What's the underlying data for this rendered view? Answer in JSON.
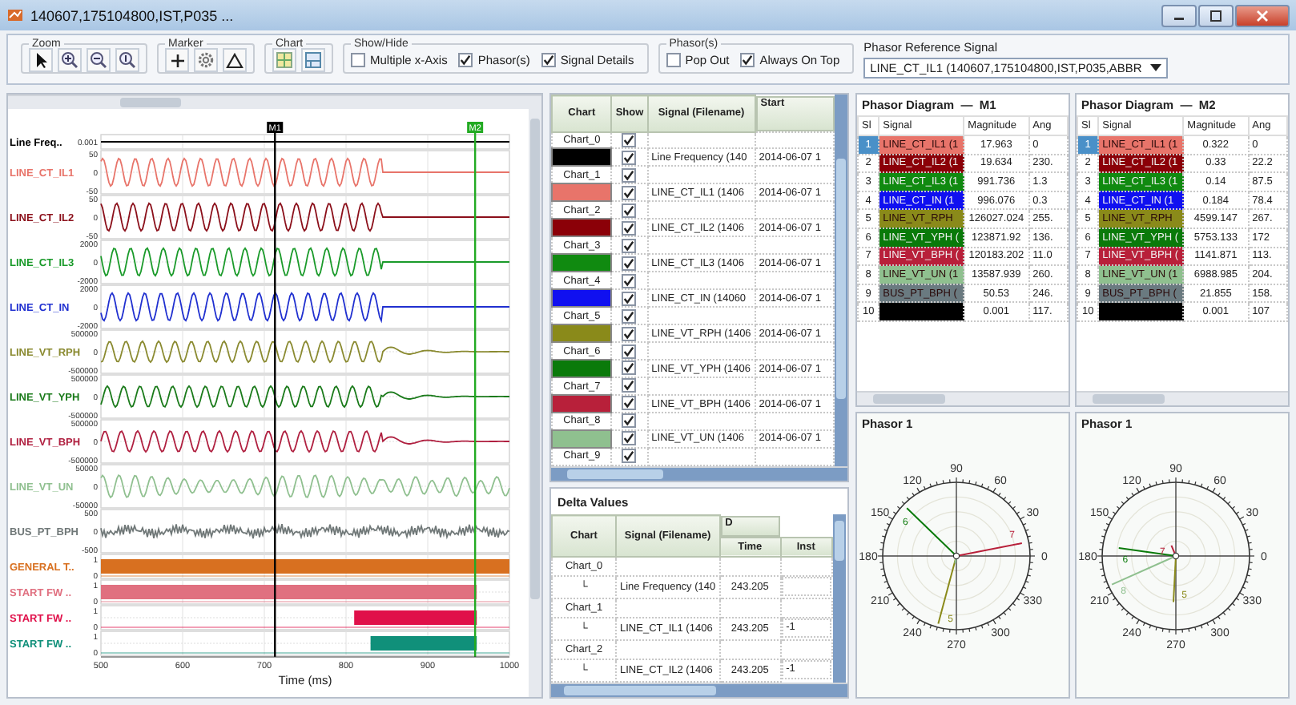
{
  "window": {
    "title": "140607,175104800,IST,P035 ..."
  },
  "toolbar": {
    "zoom": {
      "label": "Zoom"
    },
    "marker": {
      "label": "Marker"
    },
    "chart": {
      "label": "Chart"
    },
    "show_hide": {
      "label": "Show/Hide",
      "options": [
        {
          "label": "Multiple x-Axis",
          "checked": false
        },
        {
          "label": "Phasor(s)",
          "checked": true
        },
        {
          "label": "Signal Details",
          "checked": true
        }
      ]
    },
    "phasors": {
      "label": "Phasor(s)",
      "options": [
        {
          "label": "Pop Out",
          "checked": false
        },
        {
          "label": "Always On Top",
          "checked": true
        }
      ]
    },
    "reference": {
      "label": "Phasor Reference Signal",
      "value": "LINE_CT_IL1 (140607,175104800,IST,P035,ABBR"
    }
  },
  "waveforms": {
    "channels": [
      {
        "label": "Line Freq..",
        "kind": "frequency",
        "color": "#000000",
        "ticks": [
          "0.001"
        ]
      },
      {
        "label": "LINE_CT_IL1",
        "kind": "analog",
        "color": "#e8746a",
        "ticks": [
          "50",
          "0",
          "-50"
        ]
      },
      {
        "label": "LINE_CT_IL2",
        "kind": "analog",
        "color": "#8b0f1a",
        "ticks": [
          "50",
          "0",
          "-50"
        ]
      },
      {
        "label": "LINE_CT_IL3",
        "kind": "analog",
        "color": "#1a9a2a",
        "ticks": [
          "2000",
          "0",
          "-2000"
        ]
      },
      {
        "label": "LINE_CT_IN",
        "kind": "analog",
        "color": "#2030d0",
        "ticks": [
          "2000",
          "0",
          "-2000"
        ]
      },
      {
        "label": "LINE_VT_RPH",
        "kind": "analog",
        "color": "#8a8a30",
        "ticks": [
          "500000",
          "0",
          "-500000"
        ]
      },
      {
        "label": "LINE_VT_YPH",
        "kind": "analog",
        "color": "#1a7a1a",
        "ticks": [
          "500000",
          "0",
          "-500000"
        ]
      },
      {
        "label": "LINE_VT_BPH",
        "kind": "analog",
        "color": "#b02040",
        "ticks": [
          "500000",
          "0",
          "-500000"
        ]
      },
      {
        "label": "LINE_VT_UN",
        "kind": "analog",
        "color": "#90c090",
        "ticks": [
          "50000",
          "0",
          "-50000"
        ]
      },
      {
        "label": "BUS_PT_BPH",
        "kind": "noise",
        "color": "#707878",
        "ticks": [
          "500",
          "0",
          "-500"
        ]
      },
      {
        "label": "GENERAL T..",
        "kind": "digital",
        "color": "#d87020",
        "ticks": [
          "1",
          "0"
        ]
      },
      {
        "label": "START FW ..",
        "kind": "digital",
        "color": "#e07080",
        "ticks": [
          "1",
          "0"
        ]
      },
      {
        "label": "START FW ..",
        "kind": "digital",
        "color": "#e0104a",
        "ticks": [
          "1",
          "0"
        ]
      },
      {
        "label": "START FW ..",
        "kind": "digital",
        "color": "#10907a",
        "ticks": [
          "1",
          "0"
        ]
      }
    ],
    "markers": [
      {
        "label": "M1",
        "color": "#000000"
      },
      {
        "label": "M2",
        "color": "#22aa22"
      }
    ],
    "xticks": [
      "500",
      "600",
      "700",
      "800",
      "900",
      "1000"
    ],
    "xlabel": "Time (ms)"
  },
  "signal_table": {
    "columns": [
      "Chart",
      "Show",
      "Signal (Filename)",
      "Start"
    ],
    "groups": [
      {
        "chart": "Chart_0",
        "shown": true,
        "signal": {
          "color": "#000000",
          "shown": true,
          "name": "Line Frequency (140",
          "start": "2014-06-07 1"
        }
      },
      {
        "chart": "Chart_1",
        "shown": true,
        "signal": {
          "color": "#e8746a",
          "shown": true,
          "name": "LINE_CT_IL1 (1406",
          "start": "2014-06-07 1"
        }
      },
      {
        "chart": "Chart_2",
        "shown": true,
        "signal": {
          "color": "#8b0008",
          "shown": true,
          "name": "LINE_CT_IL2 (1406",
          "start": "2014-06-07 1"
        }
      },
      {
        "chart": "Chart_3",
        "shown": true,
        "signal": {
          "color": "#108a10",
          "shown": true,
          "name": "LINE_CT_IL3 (1406",
          "start": "2014-06-07 1"
        }
      },
      {
        "chart": "Chart_4",
        "shown": true,
        "signal": {
          "color": "#1010f0",
          "shown": true,
          "name": "LINE_CT_IN (14060",
          "start": "2014-06-07 1"
        }
      },
      {
        "chart": "Chart_5",
        "shown": true,
        "signal": {
          "color": "#8a8a1a",
          "shown": true,
          "name": "LINE_VT_RPH (1406",
          "start": "2014-06-07 1"
        }
      },
      {
        "chart": "Chart_6",
        "shown": true,
        "signal": {
          "color": "#0a7a0a",
          "shown": true,
          "name": "LINE_VT_YPH (1406",
          "start": "2014-06-07 1"
        }
      },
      {
        "chart": "Chart_7",
        "shown": true,
        "signal": {
          "color": "#b8203a",
          "shown": true,
          "name": "LINE_VT_BPH (1406",
          "start": "2014-06-07 1"
        }
      },
      {
        "chart": "Chart_8",
        "shown": true,
        "signal": {
          "color": "#8fc08f",
          "shown": true,
          "name": "LINE_VT_UN (1406",
          "start": "2014-06-07 1"
        }
      },
      {
        "chart": "Chart_9",
        "shown": true
      }
    ]
  },
  "delta_values": {
    "title": "Delta Values",
    "columns": [
      "Chart",
      "Signal (Filename)"
    ],
    "group_header": "D",
    "subcolumns": [
      "Time",
      "Inst"
    ],
    "groups": [
      {
        "chart": "Chart_0",
        "branch": "└",
        "signal": "Line Frequency (140",
        "time": "243.205"
      },
      {
        "chart": "Chart_1",
        "branch": "└",
        "signal": "LINE_CT_IL1 (1406",
        "time": "243.205",
        "inst": "-1"
      },
      {
        "chart": "Chart_2",
        "branch": "└",
        "signal": "LINE_CT_IL2 (1406",
        "time": "243.205",
        "inst": "-1"
      }
    ]
  },
  "phasor_panels": [
    {
      "title": "Phasor Diagram  —  M1",
      "columns": [
        "Sl",
        "Signal",
        "Magnitude",
        "Ang"
      ],
      "rows": [
        {
          "sl": "1",
          "selected": true,
          "signal": "LINE_CT_IL1 (1",
          "color": "#e8746a",
          "magnitude": "17.963",
          "angle": "0"
        },
        {
          "sl": "2",
          "selected": false,
          "signal": "LINE_CT_IL2 (1",
          "color": "#8b0008",
          "magnitude": "19.634",
          "angle": "230."
        },
        {
          "sl": "3",
          "selected": false,
          "signal": "LINE_CT_IL3 (1",
          "color": "#108a10",
          "magnitude": "991.736",
          "angle": "1.3"
        },
        {
          "sl": "4",
          "selected": false,
          "signal": "LINE_CT_IN (1",
          "color": "#1010f0",
          "magnitude": "996.076",
          "angle": "0.3"
        },
        {
          "sl": "5",
          "selected": false,
          "signal": "LINE_VT_RPH",
          "color": "#8a8a1a",
          "magnitude": "126027.024",
          "angle": "255."
        },
        {
          "sl": "6",
          "selected": false,
          "signal": "LINE_VT_YPH (",
          "color": "#0a7a0a",
          "magnitude": "123871.92",
          "angle": "136."
        },
        {
          "sl": "7",
          "selected": false,
          "signal": "LINE_VT_BPH (",
          "color": "#b8203a",
          "magnitude": "120183.202",
          "angle": "11.0"
        },
        {
          "sl": "8",
          "selected": false,
          "signal": "LINE_VT_UN (1",
          "color": "#8fc08f",
          "magnitude": "13587.939",
          "angle": "260."
        },
        {
          "sl": "9",
          "selected": false,
          "signal": "BUS_PT_BPH (",
          "color": "#6a7a80",
          "magnitude": "50.53",
          "angle": "246."
        },
        {
          "sl": "10",
          "selected": false,
          "color": "#000000",
          "magnitude": "0.001",
          "angle": "117."
        }
      ],
      "plot": {
        "title": "Phasor 1",
        "angle_labels": [
          "0",
          "30",
          "60",
          "90",
          "120",
          "150",
          "180",
          "210",
          "240",
          "270",
          "300",
          "330"
        ],
        "vector_labels": [
          "5",
          "6",
          "7"
        ]
      }
    },
    {
      "title": "Phasor Diagram  —  M2",
      "columns": [
        "Sl",
        "Signal",
        "Magnitude",
        "Ang"
      ],
      "rows": [
        {
          "sl": "1",
          "selected": true,
          "signal": "LINE_CT_IL1 (1",
          "color": "#e8746a",
          "magnitude": "0.322",
          "angle": "0"
        },
        {
          "sl": "2",
          "selected": false,
          "signal": "LINE_CT_IL2 (1",
          "color": "#8b0008",
          "magnitude": "0.33",
          "angle": "22.2"
        },
        {
          "sl": "3",
          "selected": false,
          "signal": "LINE_CT_IL3 (1",
          "color": "#108a10",
          "magnitude": "0.14",
          "angle": "87.5"
        },
        {
          "sl": "4",
          "selected": false,
          "signal": "LINE_CT_IN (1",
          "color": "#1010f0",
          "magnitude": "0.184",
          "angle": "78.4"
        },
        {
          "sl": "5",
          "selected": false,
          "signal": "LINE_VT_RPH",
          "color": "#8a8a1a",
          "magnitude": "4599.147",
          "angle": "267."
        },
        {
          "sl": "6",
          "selected": false,
          "signal": "LINE_VT_YPH (",
          "color": "#0a7a0a",
          "magnitude": "5753.133",
          "angle": "172"
        },
        {
          "sl": "7",
          "selected": false,
          "signal": "LINE_VT_BPH (",
          "color": "#b8203a",
          "magnitude": "1141.871",
          "angle": "113."
        },
        {
          "sl": "8",
          "selected": false,
          "signal": "LINE_VT_UN (1",
          "color": "#8fc08f",
          "magnitude": "6988.985",
          "angle": "204."
        },
        {
          "sl": "9",
          "selected": false,
          "signal": "BUS_PT_BPH (",
          "color": "#6a7a80",
          "magnitude": "21.855",
          "angle": "158."
        },
        {
          "sl": "10",
          "selected": false,
          "color": "#000000",
          "magnitude": "0.001",
          "angle": "107"
        }
      ],
      "plot": {
        "title": "Phasor 1",
        "angle_labels": [
          "0",
          "30",
          "60",
          "90",
          "120",
          "150",
          "180",
          "210",
          "240",
          "270",
          "300",
          "330"
        ],
        "vector_labels": [
          "5",
          "6",
          "7",
          "8"
        ]
      }
    }
  ]
}
